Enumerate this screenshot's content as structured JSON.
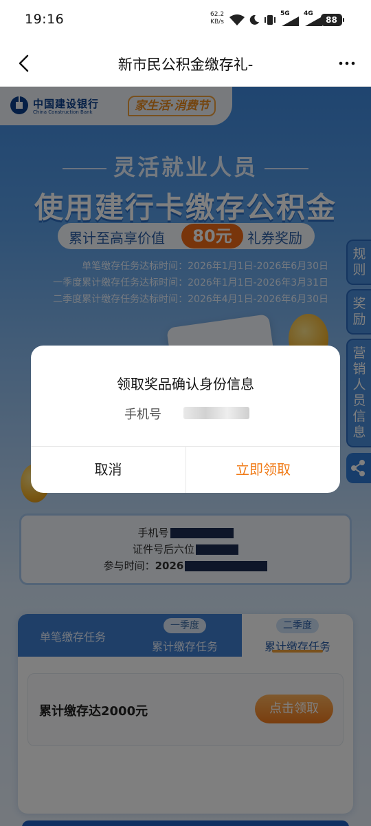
{
  "status_bar": {
    "time": "19:16",
    "net_speed_value": "62.2",
    "net_speed_unit": "KB/s",
    "sim1_label": "5G",
    "sim2_label": "4G",
    "battery": "88",
    "icons": [
      "wifi-icon",
      "do-not-disturb-moon-icon",
      "vibrate-icon",
      "signal-5g-icon",
      "signal-4g-icon",
      "battery-icon"
    ]
  },
  "navbar": {
    "title": "新市民公积金缴存礼-",
    "back_icon": "chevron-left-icon",
    "more_icon": "more-dots-icon"
  },
  "banner": {
    "bank_name_cn": "中国建设银行",
    "bank_name_en": "China Construction Bank",
    "festival": "家生活·消费节",
    "subtitle": "灵活就业人员",
    "headline": "使用建行卡缴存公积金",
    "reward_prefix": "累计至高享价值",
    "reward_amount": "80元",
    "reward_suffix": "礼券奖励",
    "periods": [
      "单笔缴存任务达标时间：2026年1月1日-2026年6月30日",
      "一季度累计缴存任务达标时间：2026年1月1日-2026年3月31日",
      "二季度累计缴存任务达标时间：2026年4月1日-2026年6月30日"
    ]
  },
  "side_tabs": {
    "rules": "规则",
    "rewards": "奖励",
    "marketer": "营销人员信息",
    "share_icon": "share-icon"
  },
  "user_info": {
    "phone_label": "手机号",
    "id_label": "证件号后六位",
    "time_label": "参与时间：",
    "time_value": "2026"
  },
  "tasks": {
    "tab1": "单笔缴存任务",
    "tab2_badge": "一季度",
    "tab2": "累计缴存任务",
    "tab3_badge": "二季度",
    "tab3": "累计缴存任务",
    "active_tab": "tab3",
    "item_title": "累计缴存达2000元",
    "item_button": "点击领取"
  },
  "dialog": {
    "title": "领取奖品确认身份信息",
    "phone_label": "手机号",
    "cancel": "取消",
    "confirm": "立即领取"
  },
  "colors": {
    "accent_orange": "#f07a16",
    "brand_blue": "#3f7fd0",
    "overlay": "rgba(0,0,0,0.5)"
  }
}
